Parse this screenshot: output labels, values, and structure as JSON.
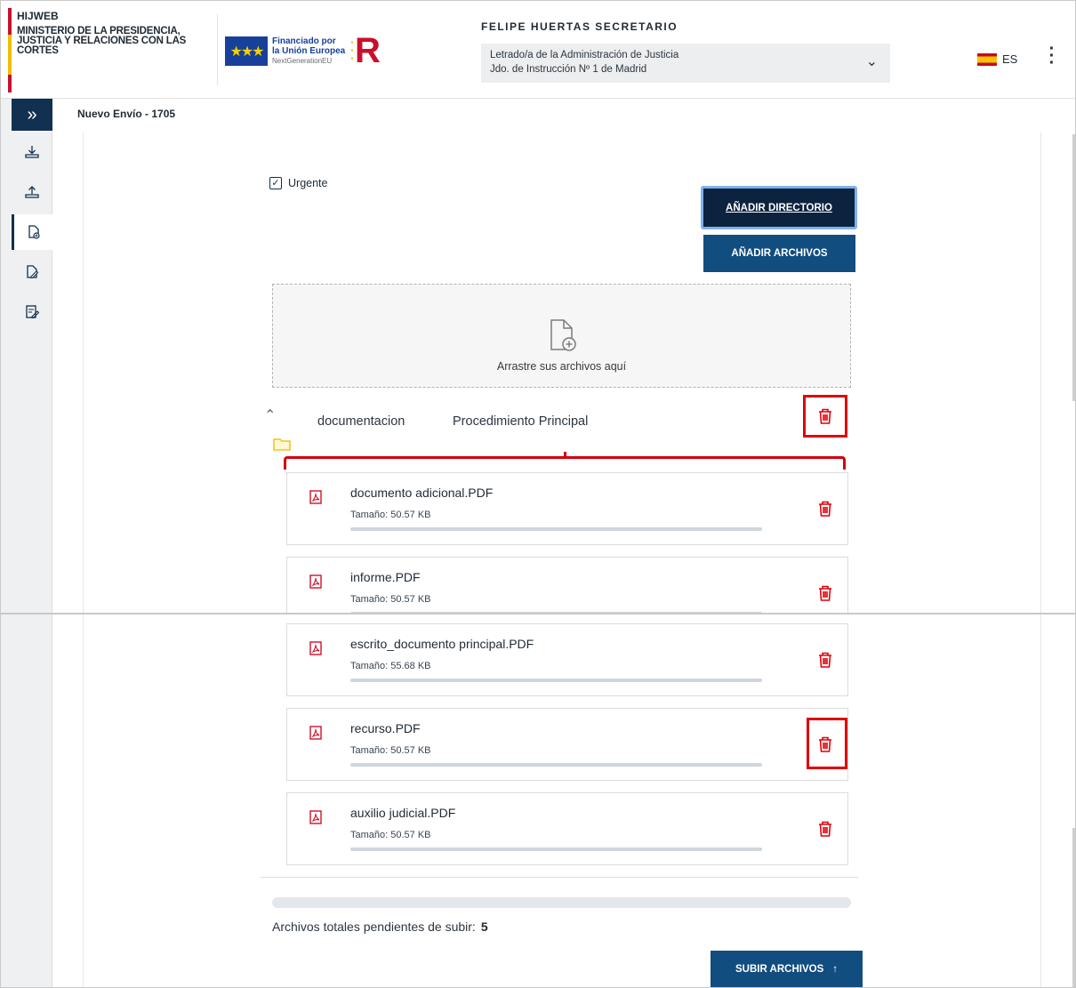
{
  "header": {
    "app_name": "HIJWEB",
    "ministry": "MINISTERIO DE LA PRESIDENCIA, JUSTICIA Y RELACIONES CON LAS CORTES",
    "eu_funding_line1": "Financiado por",
    "eu_funding_line2": "la Unión Europea",
    "eu_funding_sub": "NextGenerationEU",
    "user_name": "FELIPE HUERTAS SECRETARIO",
    "role_line1": "Letrado/a de la Administración de Justicia",
    "role_line2": "Jdo. de Instrucción Nº 1 de Madrid",
    "language": "ES"
  },
  "breadcrumb": "Nuevo Envío - 1705",
  "form": {
    "urgent_label": "Urgente",
    "urgent_checked": true,
    "add_directory_label": "AÑADIR DIRECTORIO",
    "add_files_label": "AÑADIR ARCHIVOS",
    "dropzone_text": "Arrastre sus archivos aquí"
  },
  "folder": {
    "name": "documentacion",
    "procedure": "Procedimiento Principal"
  },
  "files_top": [
    {
      "name": "documento adicional.PDF",
      "size": "Tamaño: 50.57 KB"
    },
    {
      "name": "informe.PDF",
      "size": "Tamaño: 50.57 KB"
    }
  ],
  "files_bottom": [
    {
      "name": "escrito_documento principal.PDF",
      "size": "Tamaño: 55.68 KB"
    },
    {
      "name": "recurso.PDF",
      "size": "Tamaño: 50.57 KB"
    },
    {
      "name": "auxilio judicial.PDF",
      "size": "Tamaño: 50.57 KB"
    }
  ],
  "summary": {
    "pending_label": "Archivos totales pendientes de subir:",
    "pending_count": "5",
    "upload_label": "SUBIR ARCHIVOS"
  },
  "colors": {
    "primary_dark": "#0c2340",
    "primary": "#124d80",
    "highlight_red": "#e0000b",
    "pdf_red": "#d0102a"
  },
  "icons": {
    "sidebar": [
      "expand-icon",
      "download-icon",
      "upload-icon",
      "new-file-icon",
      "edit-file-icon",
      "form-edit-icon"
    ],
    "file": "pdf-icon",
    "delete": "trash-icon",
    "upload": "arrow-up-icon"
  }
}
